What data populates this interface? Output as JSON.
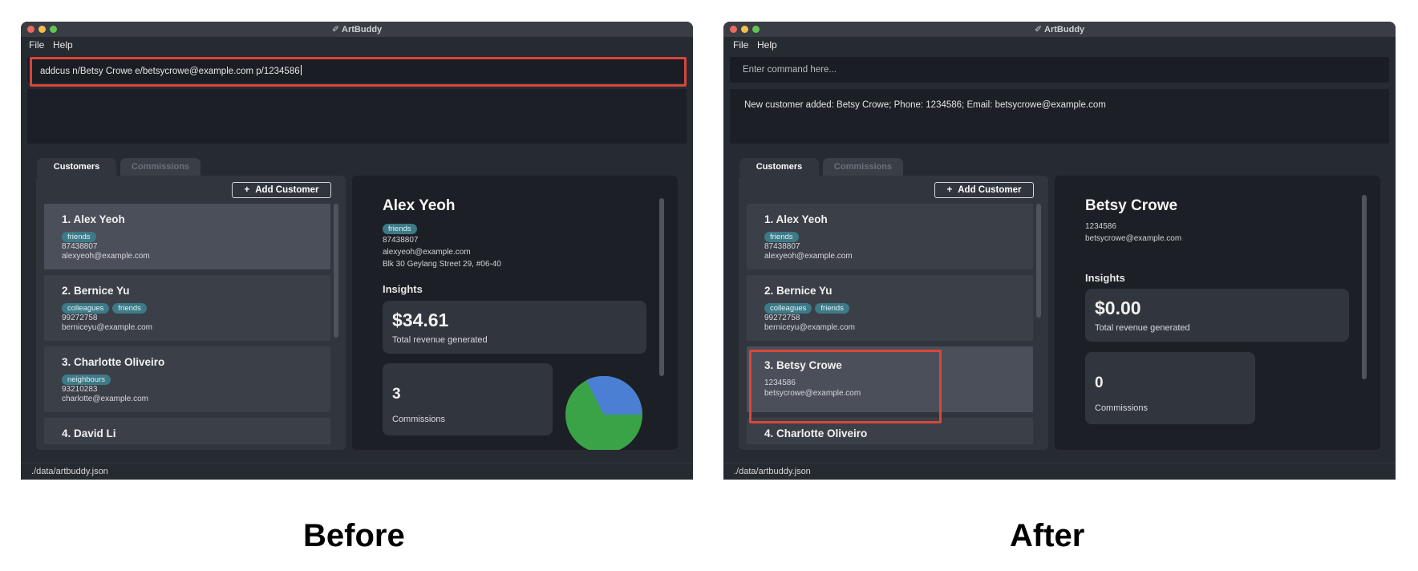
{
  "app_title": "ArtBuddy",
  "menu": [
    "File",
    "Help"
  ],
  "tabs": [
    "Customers",
    "Commissions"
  ],
  "add_customer_label": "Add Customer",
  "insights_label": "Insights",
  "revenue_label": "Total revenue generated",
  "commissions_label": "Commissions",
  "status_path": "./data/artbuddy.json",
  "captions": {
    "before": "Before",
    "after": "After"
  },
  "colors": {
    "highlight": "#d9463a",
    "tag": "#3d7a88",
    "pie_blue": "#4a7fd4",
    "pie_green": "#3aa347"
  },
  "before": {
    "command_text": "addcus n/Betsy Crowe e/betsycrowe@example.com p/1234586",
    "result_text": "",
    "customers": [
      {
        "name": "1.  Alex Yeoh",
        "tags": [
          "friends"
        ],
        "phone": "87438807",
        "email": "alexyeoh@example.com"
      },
      {
        "name": "2.  Bernice Yu",
        "tags": [
          "colleagues",
          "friends"
        ],
        "phone": "99272758",
        "email": "berniceyu@example.com"
      },
      {
        "name": "3.  Charlotte Oliveiro",
        "tags": [
          "neighbours"
        ],
        "phone": "93210283",
        "email": "charlotte@example.com"
      },
      {
        "name": "4.  David Li",
        "tags": [],
        "phone": "",
        "email": ""
      }
    ],
    "detail": {
      "name": "Alex Yeoh",
      "tag": "friends",
      "phone": "87438807",
      "email": "alexyeoh@example.com",
      "address": "Blk 30 Geylang Street 29, #06-40",
      "revenue": "$34.61",
      "commissions": "3"
    }
  },
  "after": {
    "command_placeholder": "Enter command here...",
    "result_text": "New customer added: Betsy Crowe; Phone: 1234586; Email: betsycrowe@example.com",
    "customers": [
      {
        "name": "1.  Alex Yeoh",
        "tags": [
          "friends"
        ],
        "phone": "87438807",
        "email": "alexyeoh@example.com"
      },
      {
        "name": "2.  Bernice Yu",
        "tags": [
          "colleagues",
          "friends"
        ],
        "phone": "99272758",
        "email": "berniceyu@example.com"
      },
      {
        "name": "3.  Betsy Crowe",
        "tags": [],
        "phone": "1234586",
        "email": "betsycrowe@example.com"
      },
      {
        "name": "4.  Charlotte Oliveiro",
        "tags": [],
        "phone": "",
        "email": ""
      }
    ],
    "detail": {
      "name": "Betsy Crowe",
      "phone": "1234586",
      "email": "betsycrowe@example.com",
      "revenue": "$0.00",
      "commissions": "0"
    }
  }
}
